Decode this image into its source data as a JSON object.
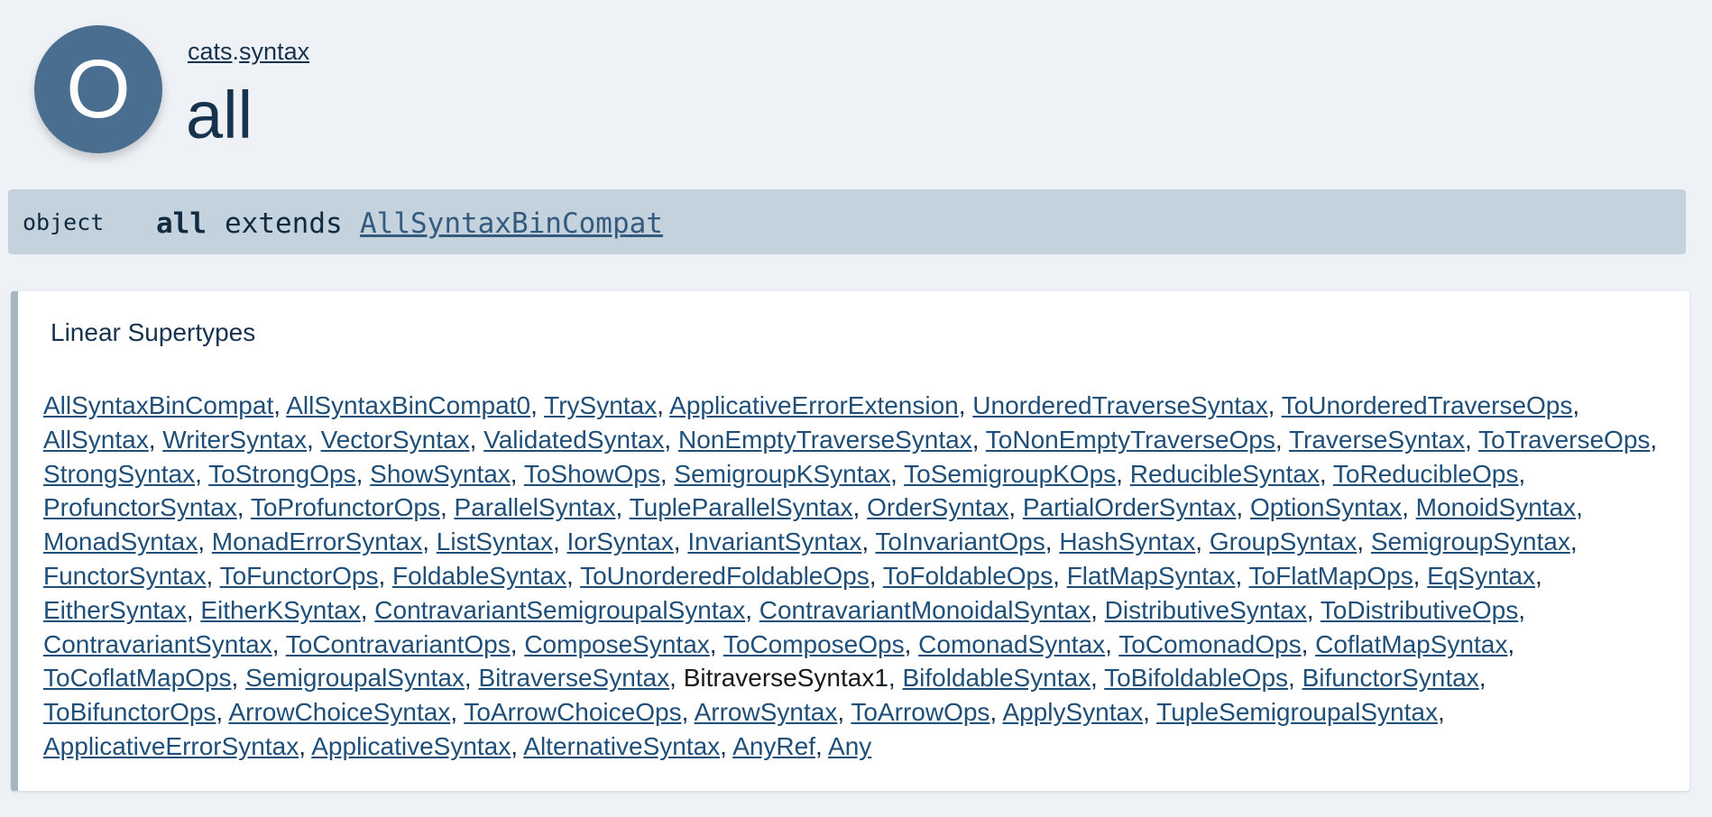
{
  "header": {
    "badge_letter": "O",
    "breadcrumb": [
      {
        "label": "cats",
        "link": true
      },
      {
        "label": ".",
        "link": false
      },
      {
        "label": "syntax",
        "link": true
      }
    ],
    "title": "all"
  },
  "signature": {
    "kind": "object",
    "name": "all",
    "keyword": "extends",
    "parent": "AllSyntaxBinCompat"
  },
  "linear_supertypes": {
    "heading": "Linear Supertypes",
    "items": [
      {
        "label": "AllSyntaxBinCompat",
        "link": true
      },
      {
        "label": "AllSyntaxBinCompat0",
        "link": true
      },
      {
        "label": "TrySyntax",
        "link": true
      },
      {
        "label": "ApplicativeErrorExtension",
        "link": true
      },
      {
        "label": "UnorderedTraverseSyntax",
        "link": true
      },
      {
        "label": "ToUnorderedTraverseOps",
        "link": true
      },
      {
        "label": "AllSyntax",
        "link": true
      },
      {
        "label": "WriterSyntax",
        "link": true
      },
      {
        "label": "VectorSyntax",
        "link": true
      },
      {
        "label": "ValidatedSyntax",
        "link": true
      },
      {
        "label": "NonEmptyTraverseSyntax",
        "link": true
      },
      {
        "label": "ToNonEmptyTraverseOps",
        "link": true
      },
      {
        "label": "TraverseSyntax",
        "link": true
      },
      {
        "label": "ToTraverseOps",
        "link": true
      },
      {
        "label": "StrongSyntax",
        "link": true
      },
      {
        "label": "ToStrongOps",
        "link": true
      },
      {
        "label": "ShowSyntax",
        "link": true
      },
      {
        "label": "ToShowOps",
        "link": true
      },
      {
        "label": "SemigroupKSyntax",
        "link": true
      },
      {
        "label": "ToSemigroupKOps",
        "link": true
      },
      {
        "label": "ReducibleSyntax",
        "link": true
      },
      {
        "label": "ToReducibleOps",
        "link": true
      },
      {
        "label": "ProfunctorSyntax",
        "link": true
      },
      {
        "label": "ToProfunctorOps",
        "link": true
      },
      {
        "label": "ParallelSyntax",
        "link": true
      },
      {
        "label": "TupleParallelSyntax",
        "link": true
      },
      {
        "label": "OrderSyntax",
        "link": true
      },
      {
        "label": "PartialOrderSyntax",
        "link": true
      },
      {
        "label": "OptionSyntax",
        "link": true
      },
      {
        "label": "MonoidSyntax",
        "link": true
      },
      {
        "label": "MonadSyntax",
        "link": true
      },
      {
        "label": "MonadErrorSyntax",
        "link": true
      },
      {
        "label": "ListSyntax",
        "link": true
      },
      {
        "label": "IorSyntax",
        "link": true
      },
      {
        "label": "InvariantSyntax",
        "link": true
      },
      {
        "label": "ToInvariantOps",
        "link": true
      },
      {
        "label": "HashSyntax",
        "link": true
      },
      {
        "label": "GroupSyntax",
        "link": true
      },
      {
        "label": "SemigroupSyntax",
        "link": true
      },
      {
        "label": "FunctorSyntax",
        "link": true
      },
      {
        "label": "ToFunctorOps",
        "link": true
      },
      {
        "label": "FoldableSyntax",
        "link": true
      },
      {
        "label": "ToUnorderedFoldableOps",
        "link": true
      },
      {
        "label": "ToFoldableOps",
        "link": true
      },
      {
        "label": "FlatMapSyntax",
        "link": true
      },
      {
        "label": "ToFlatMapOps",
        "link": true
      },
      {
        "label": "EqSyntax",
        "link": true
      },
      {
        "label": "EitherSyntax",
        "link": true
      },
      {
        "label": "EitherKSyntax",
        "link": true
      },
      {
        "label": "ContravariantSemigroupalSyntax",
        "link": true
      },
      {
        "label": "ContravariantMonoidalSyntax",
        "link": true
      },
      {
        "label": "DistributiveSyntax",
        "link": true
      },
      {
        "label": "ToDistributiveOps",
        "link": true
      },
      {
        "label": "ContravariantSyntax",
        "link": true
      },
      {
        "label": "ToContravariantOps",
        "link": true
      },
      {
        "label": "ComposeSyntax",
        "link": true
      },
      {
        "label": "ToComposeOps",
        "link": true
      },
      {
        "label": "ComonadSyntax",
        "link": true
      },
      {
        "label": "ToComonadOps",
        "link": true
      },
      {
        "label": "CoflatMapSyntax",
        "link": true
      },
      {
        "label": "ToCoflatMapOps",
        "link": true
      },
      {
        "label": "SemigroupalSyntax",
        "link": true
      },
      {
        "label": "BitraverseSyntax",
        "link": true
      },
      {
        "label": "BitraverseSyntax1",
        "link": false
      },
      {
        "label": "BifoldableSyntax",
        "link": true
      },
      {
        "label": "ToBifoldableOps",
        "link": true
      },
      {
        "label": "BifunctorSyntax",
        "link": true
      },
      {
        "label": "ToBifunctorOps",
        "link": true
      },
      {
        "label": "ArrowChoiceSyntax",
        "link": true
      },
      {
        "label": "ToArrowChoiceOps",
        "link": true
      },
      {
        "label": "ArrowSyntax",
        "link": true
      },
      {
        "label": "ToArrowOps",
        "link": true
      },
      {
        "label": "ApplySyntax",
        "link": true
      },
      {
        "label": "TupleSemigroupalSyntax",
        "link": true
      },
      {
        "label": "ApplicativeErrorSyntax",
        "link": true
      },
      {
        "label": "ApplicativeSyntax",
        "link": true
      },
      {
        "label": "AlternativeSyntax",
        "link": true
      },
      {
        "label": "AnyRef",
        "link": true
      },
      {
        "label": "Any",
        "link": true
      }
    ]
  }
}
